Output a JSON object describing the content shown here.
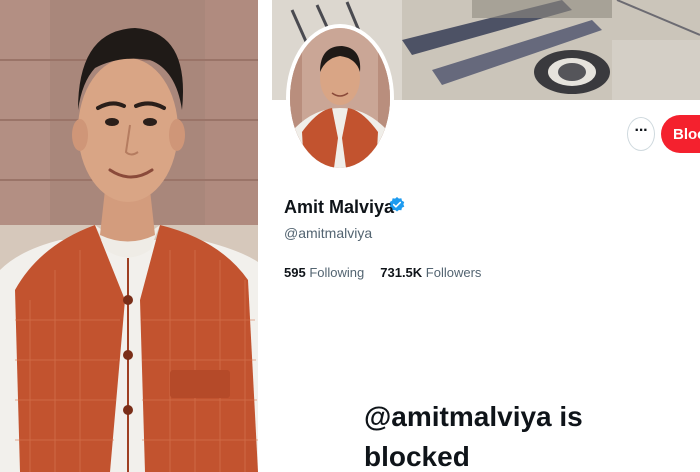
{
  "profile": {
    "display_name": "Amit Malviya",
    "handle": "@amitmalviya",
    "following_count": "595",
    "following_label": "Following",
    "followers_count": "731.5K",
    "followers_label": "Followers",
    "blocked_button_label": "Blocked",
    "more_button_label": "···",
    "blocked_message": "@amitmalviya is blocked"
  },
  "icons": {
    "verified": "verified-badge-icon",
    "more": "ellipsis-icon"
  },
  "colors": {
    "blocked_red": "#f4212e",
    "verified_blue": "#1d9bf0",
    "text_primary": "#0f1419",
    "text_secondary": "#536471",
    "vest_orange": "#c2532f"
  }
}
